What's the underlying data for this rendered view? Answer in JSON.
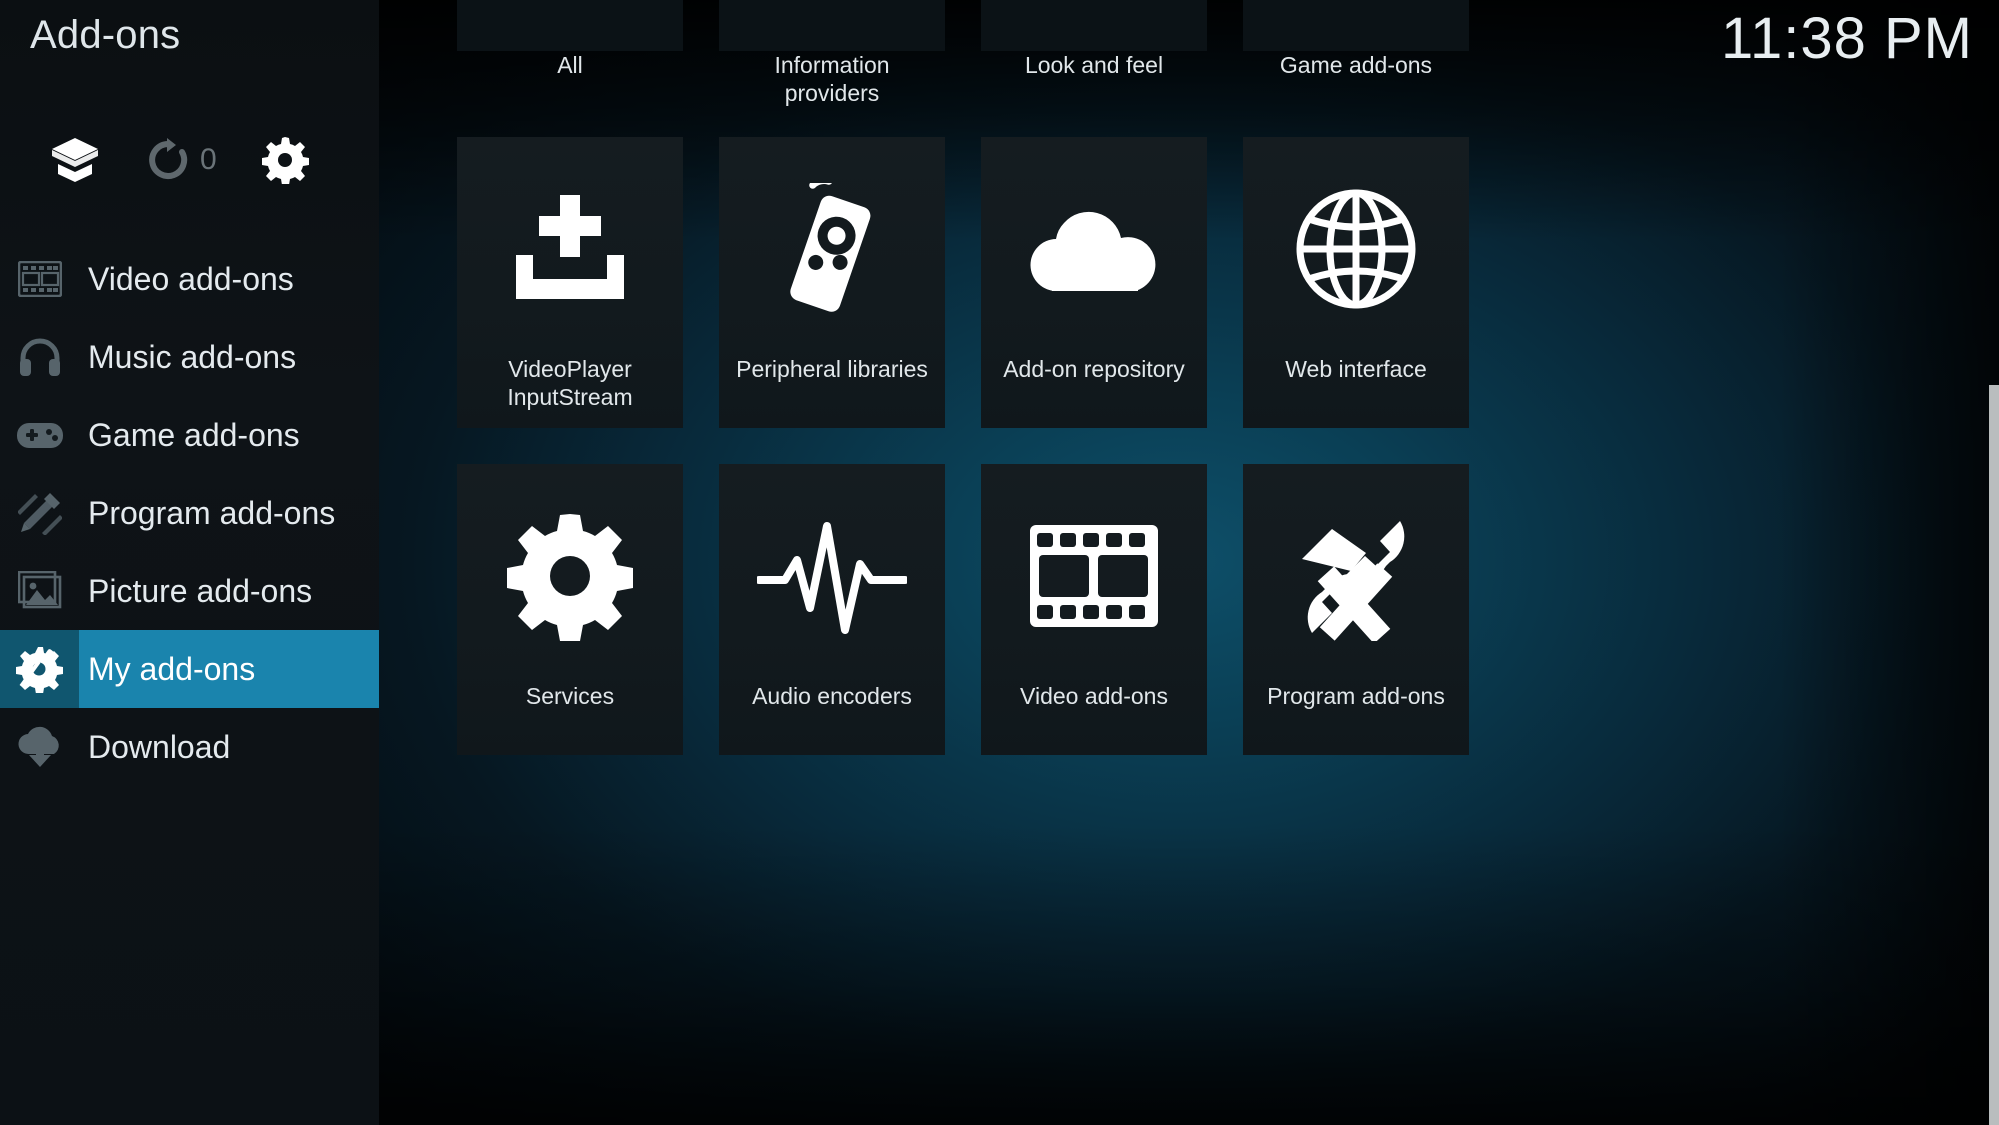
{
  "sidebar": {
    "title": "Add-ons",
    "toolbar": [
      {
        "name": "install-from-zip",
        "icon": "open-box-icon",
        "label": ""
      },
      {
        "name": "check-for-updates",
        "icon": "refresh-icon",
        "label": "",
        "count": "0"
      },
      {
        "name": "addon-settings",
        "icon": "gear-icon",
        "label": ""
      }
    ],
    "items": [
      {
        "label": "Video add-ons",
        "icon": "film-strip-icon",
        "selected": false
      },
      {
        "label": "Music add-ons",
        "icon": "headphones-icon",
        "selected": false
      },
      {
        "label": "Game add-ons",
        "icon": "gamepad-icon",
        "selected": false
      },
      {
        "label": "Program add-ons",
        "icon": "ruler-pencil-icon",
        "selected": false
      },
      {
        "label": "Picture add-ons",
        "icon": "picture-frame-icon",
        "selected": false
      },
      {
        "label": "My add-ons",
        "icon": "gear-screwdriver-icon",
        "selected": true
      },
      {
        "label": "Download",
        "icon": "cloud-download-icon",
        "selected": false
      }
    ]
  },
  "clock": "11:38 PM",
  "content": {
    "rows": [
      {
        "name": "category-row-scrolled",
        "tiles": [
          {
            "label": "All",
            "icon": ""
          },
          {
            "label": "Information providers",
            "icon": ""
          },
          {
            "label": "Look and feel",
            "icon": ""
          },
          {
            "label": "Game add-ons",
            "icon": ""
          }
        ]
      },
      {
        "name": "category-row-1",
        "tiles": [
          {
            "label": "VideoPlayer InputStream",
            "icon": "install-tray-icon"
          },
          {
            "label": "Peripheral libraries",
            "icon": "remote-control-icon"
          },
          {
            "label": "Add-on repository",
            "icon": "cloud-icon"
          },
          {
            "label": "Web interface",
            "icon": "globe-icon"
          }
        ]
      },
      {
        "name": "category-row-2",
        "tiles": [
          {
            "label": "Services",
            "icon": "gear-icon"
          },
          {
            "label": "Audio encoders",
            "icon": "waveform-icon"
          },
          {
            "label": "Video add-ons",
            "icon": "film-strip-icon"
          },
          {
            "label": "Program add-ons",
            "icon": "hammer-wrench-icon"
          }
        ]
      }
    ]
  },
  "colors": {
    "accent": "#1a84ad",
    "accent_dark": "#10566f",
    "tile_bg": "#141b1f",
    "sidebar_bg": "#0d1216",
    "text": "#e4eaee",
    "text_dim": "#6a7378",
    "scrollbar": "#b9bdbe"
  }
}
